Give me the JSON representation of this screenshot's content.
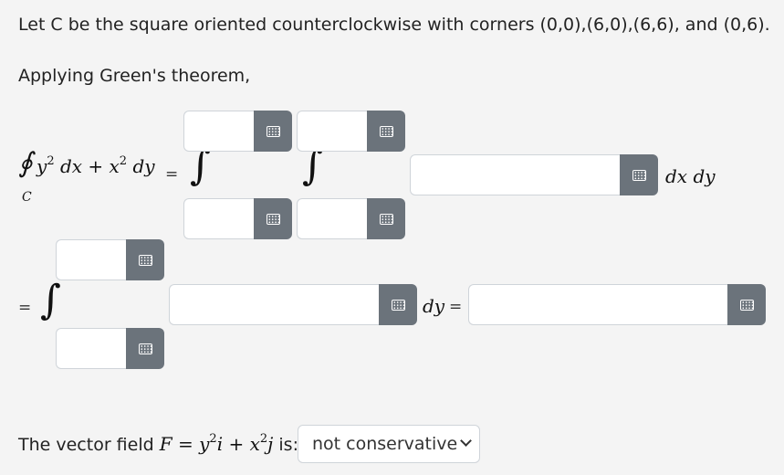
{
  "problem": {
    "statement": "Let C be the square oriented counterclockwise with corners (0,0),(6,0),(6,6), and (0,6).",
    "intro": "Applying Green's theorem,"
  },
  "line_integral": {
    "symbol": "∮",
    "term1": "y",
    "term1_exp": "2",
    "dx": "dx +",
    "term2": "x",
    "term2_exp": "2",
    "dy": "dy",
    "curve": "C"
  },
  "symbols": {
    "equals": "=",
    "integral": "∫",
    "dx_dy": "dx dy",
    "dy": "dy"
  },
  "fields": {
    "outer_upper": "",
    "outer_lower": "",
    "inner_upper": "",
    "inner_lower": "",
    "integrand": "",
    "single_upper": "",
    "single_lower": "",
    "single_integrand": "",
    "result": ""
  },
  "vector_field": {
    "prefix": "The vector field",
    "F": "F",
    "eq": "=",
    "y": "y",
    "y_exp": "2",
    "i": "i",
    "plus": "+",
    "x": "x",
    "x_exp": "2",
    "j": "j",
    "suffix": "is:",
    "selected": "not conservative"
  },
  "icons": {
    "keyboard": "keyboard-icon",
    "dropdown": "chevron-down-icon"
  }
}
